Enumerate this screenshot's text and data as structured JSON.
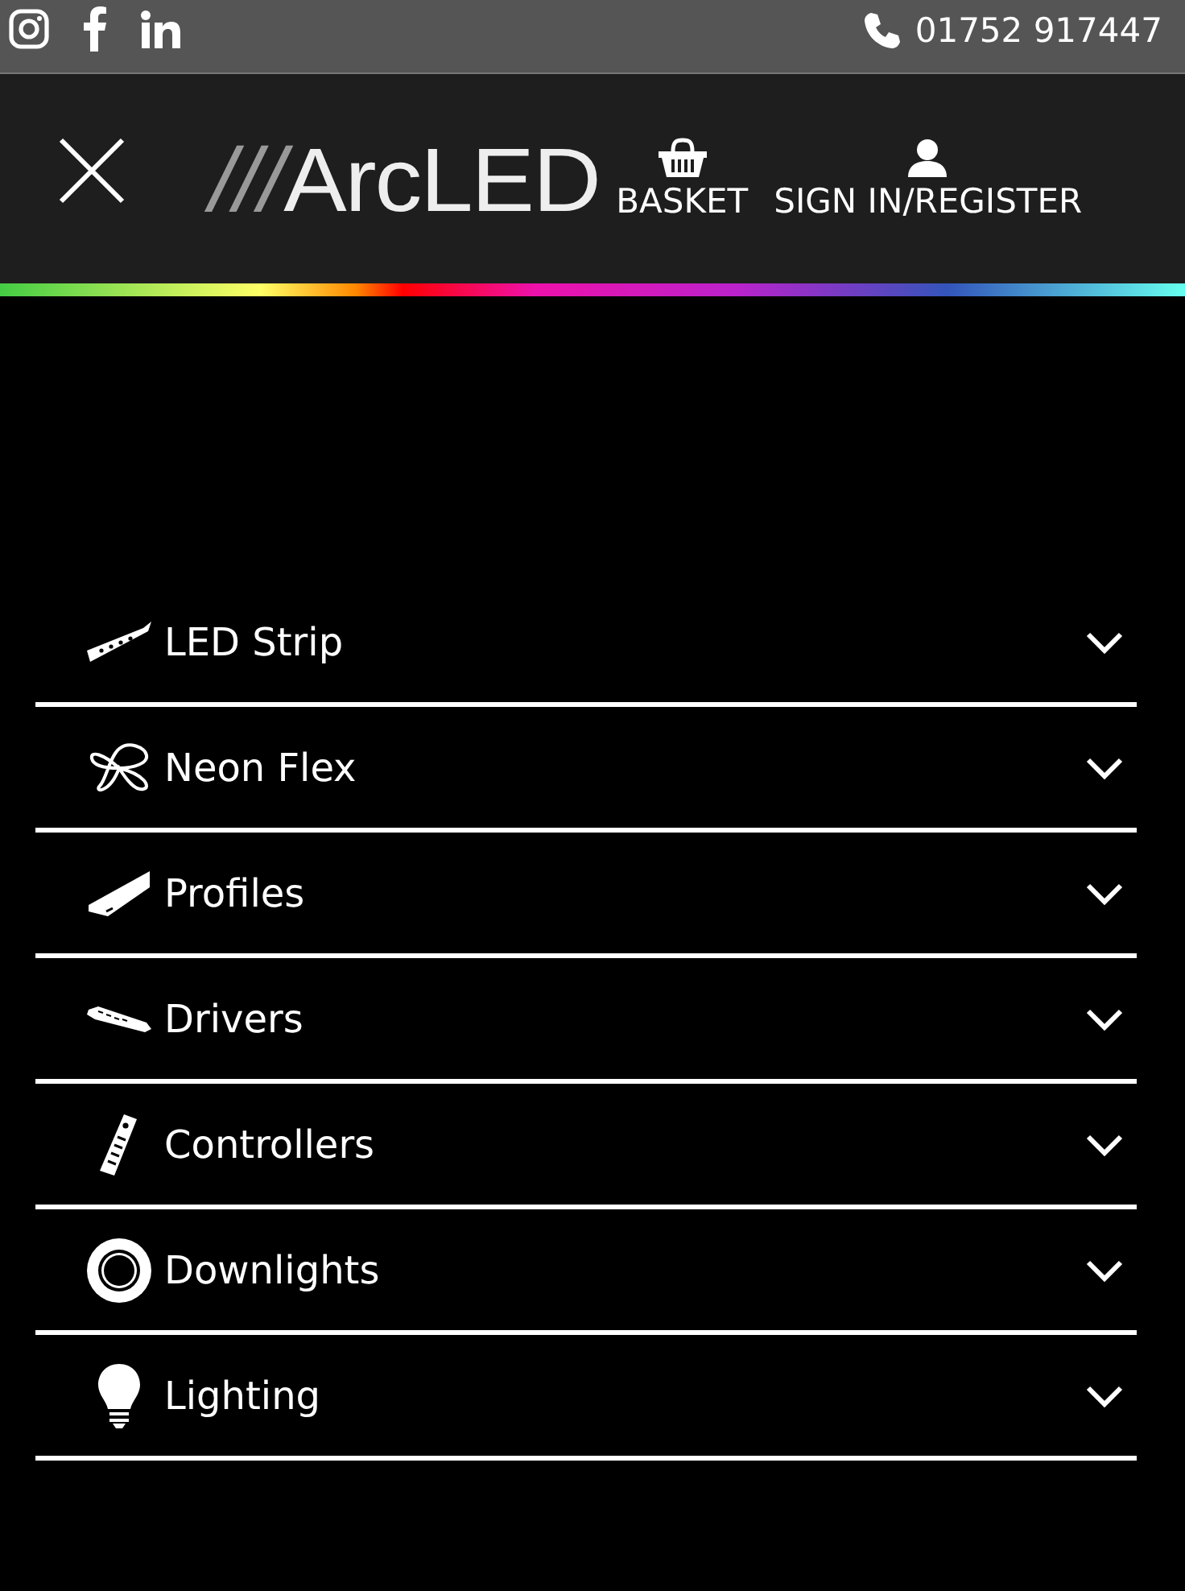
{
  "top_bar": {
    "social": [
      {
        "kind": "instagram"
      },
      {
        "kind": "facebook"
      },
      {
        "kind": "linkedin"
      }
    ],
    "phone": "01752 917447"
  },
  "header": {
    "logo": {
      "marks": "///",
      "name": "ArcLED"
    },
    "basket": "BASKET",
    "account": "SIGN IN/REGISTER"
  },
  "menu": [
    {
      "label": "LED Strip",
      "kind": "strip",
      "expanded": false
    },
    {
      "label": "Neon Flex",
      "kind": "neon",
      "expanded": false
    },
    {
      "label": "Profiles",
      "kind": "profile",
      "expanded": false
    },
    {
      "label": "Drivers",
      "kind": "driver",
      "expanded": false
    },
    {
      "label": "Controllers",
      "kind": "remote",
      "expanded": false
    },
    {
      "label": "Downlights",
      "kind": "downlight",
      "expanded": false
    },
    {
      "label": "Lighting",
      "kind": "bulb",
      "expanded": false
    }
  ]
}
